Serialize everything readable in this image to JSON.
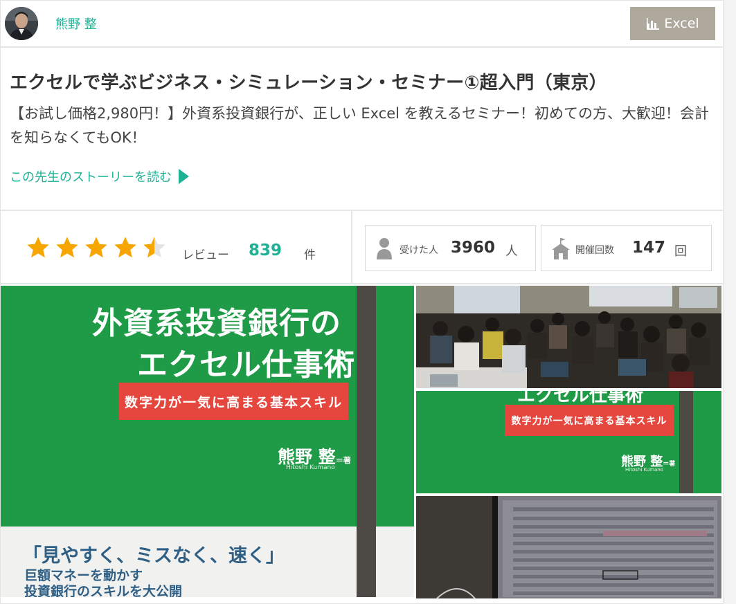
{
  "header": {
    "teacher_name": "熊野 整",
    "category_label": "Excel"
  },
  "course": {
    "title": "エクセルで学ぶビジネス・シミュレーション・セミナー①超入門（東京）",
    "description": "【お試し価格2,980円！】外資系投資銀行が、正しい Excel を教えるセミナー！初めての方、大歓迎！会計を知らなくてもOK！",
    "story_link": "この先生のストーリーを読む"
  },
  "rating": {
    "stars": 4.5,
    "review_label": "レビュー",
    "review_count": "839",
    "review_unit": "件"
  },
  "stats": {
    "attendees_label": "受けた人",
    "attendees_count": "3960",
    "attendees_unit": "人",
    "sessions_label": "開催回数",
    "sessions_count": "147",
    "sessions_unit": "回"
  },
  "book_cover": {
    "title_line1": "外資系投資銀行の",
    "title_line2": "エクセル仕事術",
    "band": "数字力が一気に高まる基本スキル",
    "author": "熊野 整",
    "author_suffix": "＝著",
    "author_roman": "Hitoshi Kumano",
    "quote": "「見やすく、ミスなく、速く」",
    "line1": "巨額マネーを動かす",
    "line2": "投資銀行のスキルを大公開"
  },
  "thumb_cover": {
    "title_fragment": "エクセル仕事術",
    "band": "数字力が一気に高まる基本スキル",
    "author": "熊野 整",
    "author_suffix": "＝著",
    "author_roman": "Hitoshi Kumano"
  },
  "colors": {
    "accent": "#1db195",
    "star": "#f7a600",
    "category_button": "#aea99c",
    "book_green": "#1f9a46",
    "book_red": "#e5473f"
  }
}
